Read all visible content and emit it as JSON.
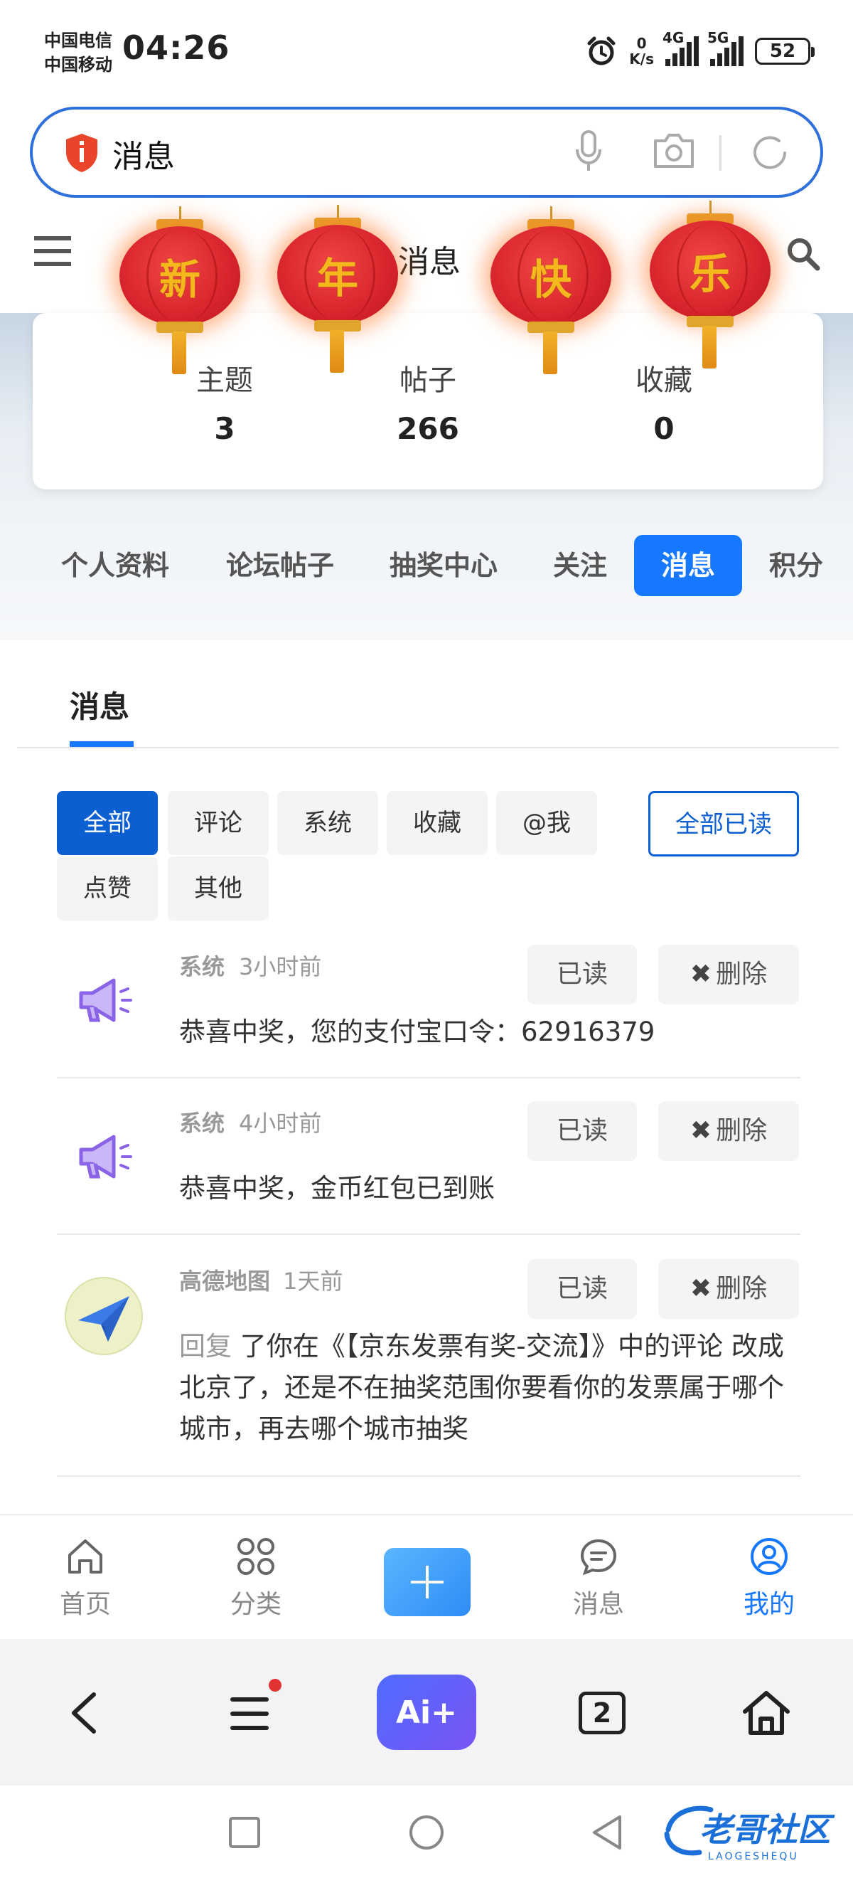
{
  "status": {
    "carrier1": "中国电信",
    "carrier2": "中国移动",
    "time": "04:26",
    "net_speed_value": "0",
    "net_speed_unit": "K/s",
    "sig1_label": "4G",
    "sig2_label": "5G",
    "battery": "52"
  },
  "search": {
    "text": "消息"
  },
  "header": {
    "title": "消息"
  },
  "lanterns": [
    "新",
    "年",
    "快",
    "乐"
  ],
  "stats": [
    {
      "label": "主题",
      "value": "3"
    },
    {
      "label": "帖子",
      "value": "266"
    },
    {
      "label": "收藏",
      "value": "0"
    }
  ],
  "profile_tabs": [
    "个人资料",
    "论坛帖子",
    "抽奖中心",
    "关注",
    "消息",
    "积分"
  ],
  "panel": {
    "title": "消息",
    "filters": [
      "全部",
      "评论",
      "系统",
      "收藏",
      "@我",
      "点赞",
      "其他"
    ],
    "mark_all": "全部已读"
  },
  "messages": [
    {
      "sender": "系统",
      "time": "3小时前",
      "read": "已读",
      "delete": "删除",
      "content": "恭喜中奖，您的支付宝口令：62916379"
    },
    {
      "sender": "系统",
      "time": "4小时前",
      "read": "已读",
      "delete": "删除",
      "content": "恭喜中奖，金币红包已到账"
    },
    {
      "sender": "高德地图",
      "time": "1天前",
      "read": "已读",
      "delete": "删除",
      "prefix": "回复",
      "content": " 了你在《【京东发票有奖-交流】》中的评论 改成北京了，还是不在抽奖范围你要看你的发票属于哪个城市，再去哪个城市抽奖"
    }
  ],
  "app_nav": [
    "首页",
    "分类",
    "消息",
    "我的"
  ],
  "browser": {
    "ai_label": "Ai+",
    "tab_count": "2"
  },
  "watermark": {
    "text": "老哥社区",
    "sub": "LAOGESHEQU"
  },
  "colors": {
    "accent": "#1677ff",
    "filter_active": "#0c5fd1",
    "search_border": "#2f6fdb",
    "lantern_red": "#d8242c",
    "lantern_gold": "#f5b81c"
  }
}
